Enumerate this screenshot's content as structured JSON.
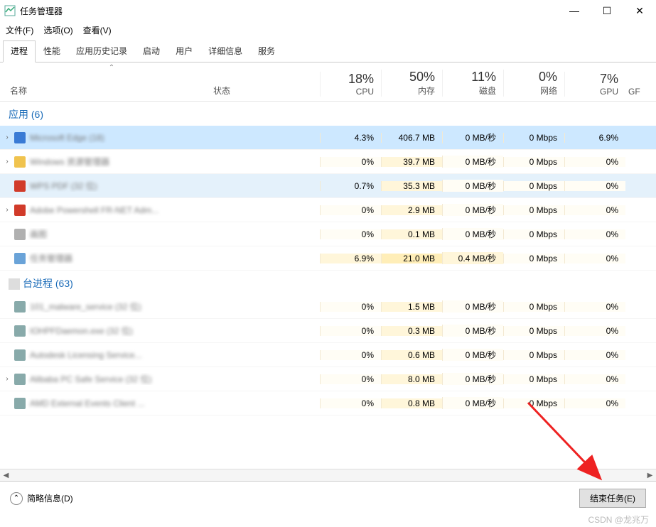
{
  "window": {
    "title": "任务管理器",
    "minimize": "—",
    "maximize": "☐",
    "close": "✕"
  },
  "menu": {
    "file": "文件(F)",
    "options": "选项(O)",
    "view": "查看(V)"
  },
  "tabs": [
    {
      "label": "进程",
      "active": true
    },
    {
      "label": "性能",
      "active": false
    },
    {
      "label": "应用历史记录",
      "active": false
    },
    {
      "label": "启动",
      "active": false
    },
    {
      "label": "用户",
      "active": false
    },
    {
      "label": "详细信息",
      "active": false
    },
    {
      "label": "服务",
      "active": false
    }
  ],
  "columns": {
    "name": "名称",
    "status": "状态",
    "cpu": {
      "pct": "18%",
      "label": "CPU"
    },
    "mem": {
      "pct": "50%",
      "label": "内存"
    },
    "disk": {
      "pct": "11%",
      "label": "磁盘"
    },
    "net": {
      "pct": "0%",
      "label": "网络"
    },
    "gpu": {
      "pct": "7%",
      "label": "GPU"
    },
    "gpe": "GF",
    "sort_indicator": "⌃"
  },
  "groups": [
    {
      "title": "应用 (6)",
      "show_icon": false,
      "rows": [
        {
          "exp": "›",
          "icon": "#3a7bd5",
          "name": "Microsoft Edge (18)",
          "selected": true,
          "cells": [
            "4.3%",
            "406.7 MB",
            "0 MB/秒",
            "0 Mbps",
            "6.9%"
          ],
          "heat": [
            "heatblue",
            "heat2",
            "heat0",
            "heat0",
            "heat1"
          ]
        },
        {
          "exp": "›",
          "icon": "#f0c34e",
          "name": "Windows 资源管理器",
          "selected": false,
          "cells": [
            "0%",
            "39.7 MB",
            "0 MB/秒",
            "0 Mbps",
            "0%"
          ],
          "heat": [
            "heat0",
            "heat1",
            "heat0",
            "heat0",
            "heat0"
          ]
        },
        {
          "exp": "",
          "icon": "#d13b2a",
          "name": "WPS PDF (32 位)",
          "selected": false,
          "cells": [
            "0.7%",
            "35.3 MB",
            "0 MB/秒",
            "0 Mbps",
            "0%"
          ],
          "heat": [
            "heatblue",
            "heat1",
            "heat0",
            "heat0",
            "heat0"
          ],
          "row_bg": "#e4f1fb"
        },
        {
          "exp": "›",
          "icon": "#d13b2a",
          "name": "Adobe Powershell FR-NET Adm...",
          "selected": false,
          "cells": [
            "0%",
            "2.9 MB",
            "0 MB/秒",
            "0 Mbps",
            "0%"
          ],
          "heat": [
            "heat0",
            "heat1",
            "heat0",
            "heat0",
            "heat0"
          ]
        },
        {
          "exp": "",
          "icon": "#b0b0b0",
          "name": "画图",
          "selected": false,
          "cells": [
            "0%",
            "0.1 MB",
            "0 MB/秒",
            "0 Mbps",
            "0%"
          ],
          "heat": [
            "heat0",
            "heat1",
            "heat0",
            "heat0",
            "heat0"
          ]
        },
        {
          "exp": "",
          "icon": "#6aa3d8",
          "name": "任务管理器",
          "selected": false,
          "cells": [
            "6.9%",
            "21.0 MB",
            "0.4 MB/秒",
            "0 Mbps",
            "0%"
          ],
          "heat": [
            "heat1",
            "heat2",
            "heat1",
            "heat0",
            "heat0"
          ]
        }
      ]
    },
    {
      "title": "台进程 (63)",
      "show_icon": true,
      "rows": [
        {
          "exp": "",
          "icon": "#8aa",
          "name": "101_malware_service (32 位)",
          "selected": false,
          "cells": [
            "0%",
            "1.5 MB",
            "0 MB/秒",
            "0 Mbps",
            "0%"
          ],
          "heat": [
            "heat0",
            "heat1",
            "heat0",
            "heat0",
            "heat0"
          ]
        },
        {
          "exp": "",
          "icon": "#8aa",
          "name": "IOHPFDaemon.exe (32 位)",
          "selected": false,
          "cells": [
            "0%",
            "0.3 MB",
            "0 MB/秒",
            "0 Mbps",
            "0%"
          ],
          "heat": [
            "heat0",
            "heat1",
            "heat0",
            "heat0",
            "heat0"
          ]
        },
        {
          "exp": "",
          "icon": "#8aa",
          "name": "Autodesk Licensing Service...",
          "selected": false,
          "cells": [
            "0%",
            "0.6 MB",
            "0 MB/秒",
            "0 Mbps",
            "0%"
          ],
          "heat": [
            "heat0",
            "heat1",
            "heat0",
            "heat0",
            "heat0"
          ]
        },
        {
          "exp": "›",
          "icon": "#8aa",
          "name": "Alibaba PC Safe Service (32 位)",
          "selected": false,
          "cells": [
            "0%",
            "8.0 MB",
            "0 MB/秒",
            "0 Mbps",
            "0%"
          ],
          "heat": [
            "heat0",
            "heat1",
            "heat0",
            "heat0",
            "heat0"
          ]
        },
        {
          "exp": "",
          "icon": "#8aa",
          "name": "AMD External Events Client ...",
          "selected": false,
          "cells": [
            "0%",
            "0.8 MB",
            "0 MB/秒",
            "0 Mbps",
            "0%"
          ],
          "heat": [
            "heat0",
            "heat1",
            "heat0",
            "heat0",
            "heat0"
          ]
        }
      ]
    }
  ],
  "footer": {
    "fewer": "简略信息(D)",
    "endtask": "结束任务(E)"
  },
  "watermark": "CSDN @龙兆万"
}
